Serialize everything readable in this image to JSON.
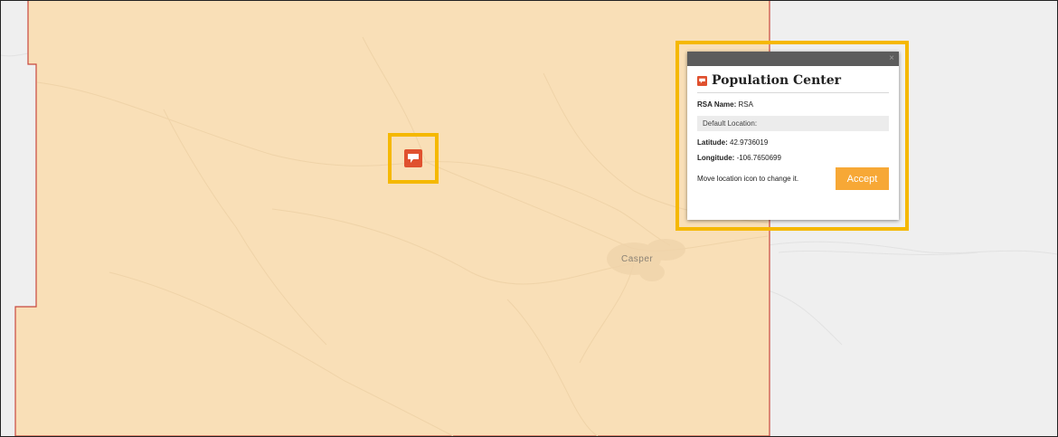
{
  "map": {
    "city_label": "Casper",
    "region_fill": "#f9dfb7",
    "region_border": "#c8473e",
    "background": "#efefef"
  },
  "marker": {
    "icon": "population-center-icon",
    "color": "#e0512f",
    "highlight_color": "#f5b800"
  },
  "popup": {
    "close_label": "×",
    "title": "Population Center",
    "title_icon": "population-center-icon",
    "rsa_name_label": "RSA Name:",
    "rsa_name_value": "RSA",
    "default_location_label": "Default Location:",
    "latitude_label": "Latitude:",
    "latitude_value": "42.9736019",
    "longitude_label": "Longitude:",
    "longitude_value": "-106.7650699",
    "move_hint": "Move location icon to change it.",
    "accept_label": "Accept",
    "accept_color": "#f7a836",
    "highlight_color": "#f5b800"
  }
}
